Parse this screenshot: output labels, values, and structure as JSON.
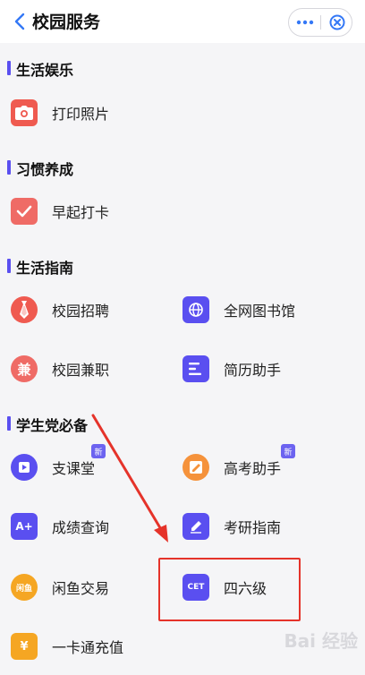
{
  "header": {
    "title": "校园服务"
  },
  "sections": [
    {
      "title": "生活娱乐",
      "items": [
        {
          "label": "打印照片",
          "icon": "camera-icon",
          "color": "#ef5a50"
        }
      ]
    },
    {
      "title": "习惯养成",
      "items": [
        {
          "label": "早起打卡",
          "icon": "check-icon",
          "color": "#ef6b66"
        }
      ]
    },
    {
      "title": "生活指南",
      "items": [
        {
          "label": "校园招聘",
          "icon": "tie-icon",
          "color": "#ef5a50"
        },
        {
          "label": "全网图书馆",
          "icon": "globe-book-icon",
          "color": "#5a4ff0"
        },
        {
          "label": "校园兼职",
          "icon": "part-time-icon",
          "glyph": "兼",
          "color": "#ef6b66"
        },
        {
          "label": "简历助手",
          "icon": "resume-icon",
          "color": "#5a4ff0"
        }
      ]
    },
    {
      "title": "学生党必备",
      "items": [
        {
          "label": "支课堂",
          "icon": "classroom-icon",
          "color": "#5a4ff0",
          "badge": "新"
        },
        {
          "label": "高考助手",
          "icon": "exam-assistant-icon",
          "color": "#f5923b",
          "badge": "新"
        },
        {
          "label": "成绩查询",
          "icon": "grade-icon",
          "glyph": "A+",
          "color": "#5a4ff0"
        },
        {
          "label": "考研指南",
          "icon": "pencil-icon",
          "color": "#5a4ff0"
        },
        {
          "label": "闲鱼交易",
          "icon": "fish-market-icon",
          "glyph": "闲鱼",
          "color": "#f5a623"
        },
        {
          "label": "四六级",
          "icon": "cet-icon",
          "glyph": "CET",
          "color": "#5a4ff0"
        },
        {
          "label": "一卡通充值",
          "icon": "card-recharge-icon",
          "glyph": "¥",
          "color": "#f5a623"
        }
      ]
    }
  ],
  "watermark": "Bai 经验"
}
